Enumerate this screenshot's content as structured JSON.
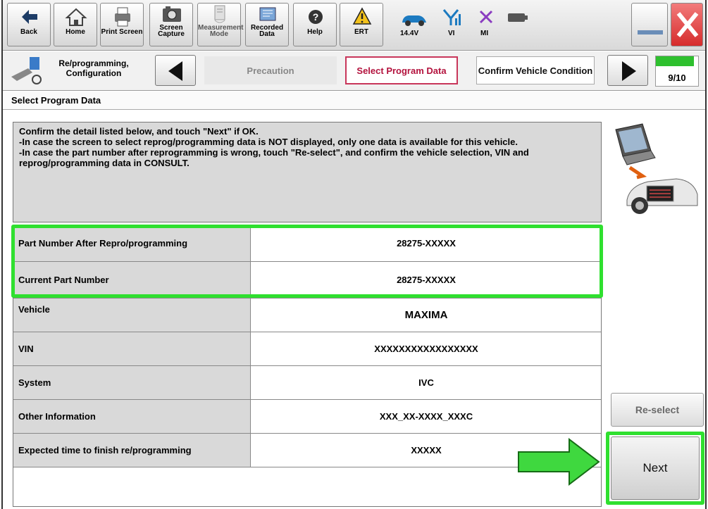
{
  "toolbar": {
    "back_label": "Back",
    "home_label": "Home",
    "print_screen_label": "Print Screen",
    "screen_capture_label": "Screen Capture",
    "measurement_mode_label": "Measurement Mode",
    "recorded_data_label": "Recorded Data",
    "help_label": "Help",
    "ert_label": "ERT",
    "voltage": "14.4V",
    "vi_label": "VI",
    "mi_label": "MI"
  },
  "breadcrumb": {
    "app_label": "Re/programming, Configuration",
    "steps": [
      "Precaution",
      "Select Program Data",
      "Confirm Vehicle Condition"
    ],
    "current_step": "Select Program Data",
    "progress_text": "9/10",
    "progress_fraction": 0.9
  },
  "section_title": "Select Program Data",
  "instructions": [
    "Confirm the detail listed below, and touch \"Next\" if OK.",
    "-In case the screen to select reprog/programming data is NOT displayed, only one data is available for this vehicle.",
    "-In case the part number after reprogramming is wrong, touch \"Re-select\", and confirm the vehicle selection, VIN and reprog/programming data in CONSULT."
  ],
  "table": {
    "rows": [
      {
        "label": "Part Number After Repro/programming",
        "value": "28275-XXXXX"
      },
      {
        "label": "Current Part Number",
        "value": "28275-XXXXX"
      },
      {
        "label": "Vehicle",
        "value": "MAXIMA"
      },
      {
        "label": "VIN",
        "value": "XXXXXXXXXXXXXXXXX"
      },
      {
        "label": "System",
        "value": "IVC"
      },
      {
        "label": "Other Information",
        "value": "XXX_XX-XXXX_XXXC"
      },
      {
        "label": "Expected time to finish re/programming",
        "value": "XXXXX"
      }
    ]
  },
  "buttons": {
    "reselect_label": "Re-select",
    "next_label": "Next"
  },
  "colors": {
    "highlight_green": "#2fe02f",
    "current_step_red": "#b3123d",
    "close_red": "#e03030"
  }
}
